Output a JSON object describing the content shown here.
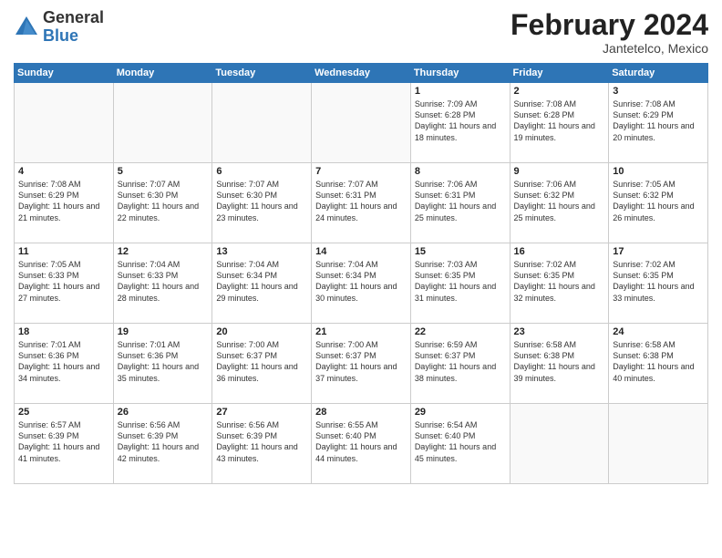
{
  "header": {
    "logo_general": "General",
    "logo_blue": "Blue",
    "month_title": "February 2024",
    "location": "Jantetelco, Mexico"
  },
  "days_of_week": [
    "Sunday",
    "Monday",
    "Tuesday",
    "Wednesday",
    "Thursday",
    "Friday",
    "Saturday"
  ],
  "weeks": [
    [
      {
        "num": "",
        "info": ""
      },
      {
        "num": "",
        "info": ""
      },
      {
        "num": "",
        "info": ""
      },
      {
        "num": "",
        "info": ""
      },
      {
        "num": "1",
        "info": "Sunrise: 7:09 AM\nSunset: 6:28 PM\nDaylight: 11 hours\nand 18 minutes."
      },
      {
        "num": "2",
        "info": "Sunrise: 7:08 AM\nSunset: 6:28 PM\nDaylight: 11 hours\nand 19 minutes."
      },
      {
        "num": "3",
        "info": "Sunrise: 7:08 AM\nSunset: 6:29 PM\nDaylight: 11 hours\nand 20 minutes."
      }
    ],
    [
      {
        "num": "4",
        "info": "Sunrise: 7:08 AM\nSunset: 6:29 PM\nDaylight: 11 hours\nand 21 minutes."
      },
      {
        "num": "5",
        "info": "Sunrise: 7:07 AM\nSunset: 6:30 PM\nDaylight: 11 hours\nand 22 minutes."
      },
      {
        "num": "6",
        "info": "Sunrise: 7:07 AM\nSunset: 6:30 PM\nDaylight: 11 hours\nand 23 minutes."
      },
      {
        "num": "7",
        "info": "Sunrise: 7:07 AM\nSunset: 6:31 PM\nDaylight: 11 hours\nand 24 minutes."
      },
      {
        "num": "8",
        "info": "Sunrise: 7:06 AM\nSunset: 6:31 PM\nDaylight: 11 hours\nand 25 minutes."
      },
      {
        "num": "9",
        "info": "Sunrise: 7:06 AM\nSunset: 6:32 PM\nDaylight: 11 hours\nand 25 minutes."
      },
      {
        "num": "10",
        "info": "Sunrise: 7:05 AM\nSunset: 6:32 PM\nDaylight: 11 hours\nand 26 minutes."
      }
    ],
    [
      {
        "num": "11",
        "info": "Sunrise: 7:05 AM\nSunset: 6:33 PM\nDaylight: 11 hours\nand 27 minutes."
      },
      {
        "num": "12",
        "info": "Sunrise: 7:04 AM\nSunset: 6:33 PM\nDaylight: 11 hours\nand 28 minutes."
      },
      {
        "num": "13",
        "info": "Sunrise: 7:04 AM\nSunset: 6:34 PM\nDaylight: 11 hours\nand 29 minutes."
      },
      {
        "num": "14",
        "info": "Sunrise: 7:04 AM\nSunset: 6:34 PM\nDaylight: 11 hours\nand 30 minutes."
      },
      {
        "num": "15",
        "info": "Sunrise: 7:03 AM\nSunset: 6:35 PM\nDaylight: 11 hours\nand 31 minutes."
      },
      {
        "num": "16",
        "info": "Sunrise: 7:02 AM\nSunset: 6:35 PM\nDaylight: 11 hours\nand 32 minutes."
      },
      {
        "num": "17",
        "info": "Sunrise: 7:02 AM\nSunset: 6:35 PM\nDaylight: 11 hours\nand 33 minutes."
      }
    ],
    [
      {
        "num": "18",
        "info": "Sunrise: 7:01 AM\nSunset: 6:36 PM\nDaylight: 11 hours\nand 34 minutes."
      },
      {
        "num": "19",
        "info": "Sunrise: 7:01 AM\nSunset: 6:36 PM\nDaylight: 11 hours\nand 35 minutes."
      },
      {
        "num": "20",
        "info": "Sunrise: 7:00 AM\nSunset: 6:37 PM\nDaylight: 11 hours\nand 36 minutes."
      },
      {
        "num": "21",
        "info": "Sunrise: 7:00 AM\nSunset: 6:37 PM\nDaylight: 11 hours\nand 37 minutes."
      },
      {
        "num": "22",
        "info": "Sunrise: 6:59 AM\nSunset: 6:37 PM\nDaylight: 11 hours\nand 38 minutes."
      },
      {
        "num": "23",
        "info": "Sunrise: 6:58 AM\nSunset: 6:38 PM\nDaylight: 11 hours\nand 39 minutes."
      },
      {
        "num": "24",
        "info": "Sunrise: 6:58 AM\nSunset: 6:38 PM\nDaylight: 11 hours\nand 40 minutes."
      }
    ],
    [
      {
        "num": "25",
        "info": "Sunrise: 6:57 AM\nSunset: 6:39 PM\nDaylight: 11 hours\nand 41 minutes."
      },
      {
        "num": "26",
        "info": "Sunrise: 6:56 AM\nSunset: 6:39 PM\nDaylight: 11 hours\nand 42 minutes."
      },
      {
        "num": "27",
        "info": "Sunrise: 6:56 AM\nSunset: 6:39 PM\nDaylight: 11 hours\nand 43 minutes."
      },
      {
        "num": "28",
        "info": "Sunrise: 6:55 AM\nSunset: 6:40 PM\nDaylight: 11 hours\nand 44 minutes."
      },
      {
        "num": "29",
        "info": "Sunrise: 6:54 AM\nSunset: 6:40 PM\nDaylight: 11 hours\nand 45 minutes."
      },
      {
        "num": "",
        "info": ""
      },
      {
        "num": "",
        "info": ""
      }
    ]
  ]
}
